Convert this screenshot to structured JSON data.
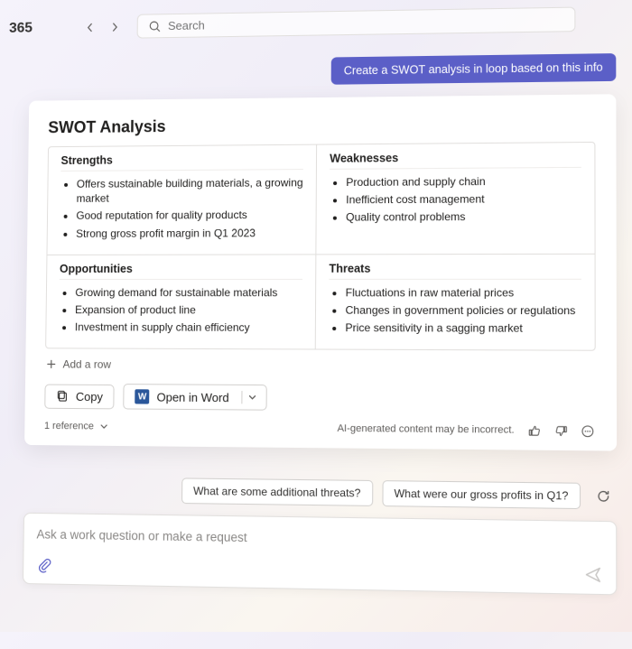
{
  "brand": "365",
  "search": {
    "placeholder": "Search"
  },
  "conversation": {
    "user_message": "Create a SWOT analysis in loop based on this info"
  },
  "card": {
    "title": "SWOT Analysis",
    "quadrants": {
      "strengths": {
        "heading": "Strengths",
        "items": [
          "Offers sustainable building materials, a growing market",
          "Good reputation for quality products",
          "Strong gross profit margin in Q1 2023"
        ]
      },
      "weaknesses": {
        "heading": "Weaknesses",
        "items": [
          "Production and supply chain",
          "Inefficient cost management",
          "Quality control problems"
        ]
      },
      "opportunities": {
        "heading": "Opportunities",
        "items": [
          "Growing demand for sustainable materials",
          "Expansion of product line",
          "Investment in supply chain efficiency"
        ]
      },
      "threats": {
        "heading": "Threats",
        "items": [
          "Fluctuations in raw material prices",
          "Changes in government policies or regulations",
          "Price sensitivity in a sagging market"
        ]
      }
    },
    "add_row_label": "Add a row",
    "actions": {
      "copy": "Copy",
      "open_in_word": "Open in Word"
    },
    "references_label": "1 reference",
    "disclaimer": "AI-generated content may be incorrect."
  },
  "suggestions": [
    "What are some additional threats?",
    "What were our gross profits in Q1?"
  ],
  "composer": {
    "placeholder": "Ask a work question or make a request"
  },
  "colors": {
    "accent": "#5b5fc7"
  }
}
